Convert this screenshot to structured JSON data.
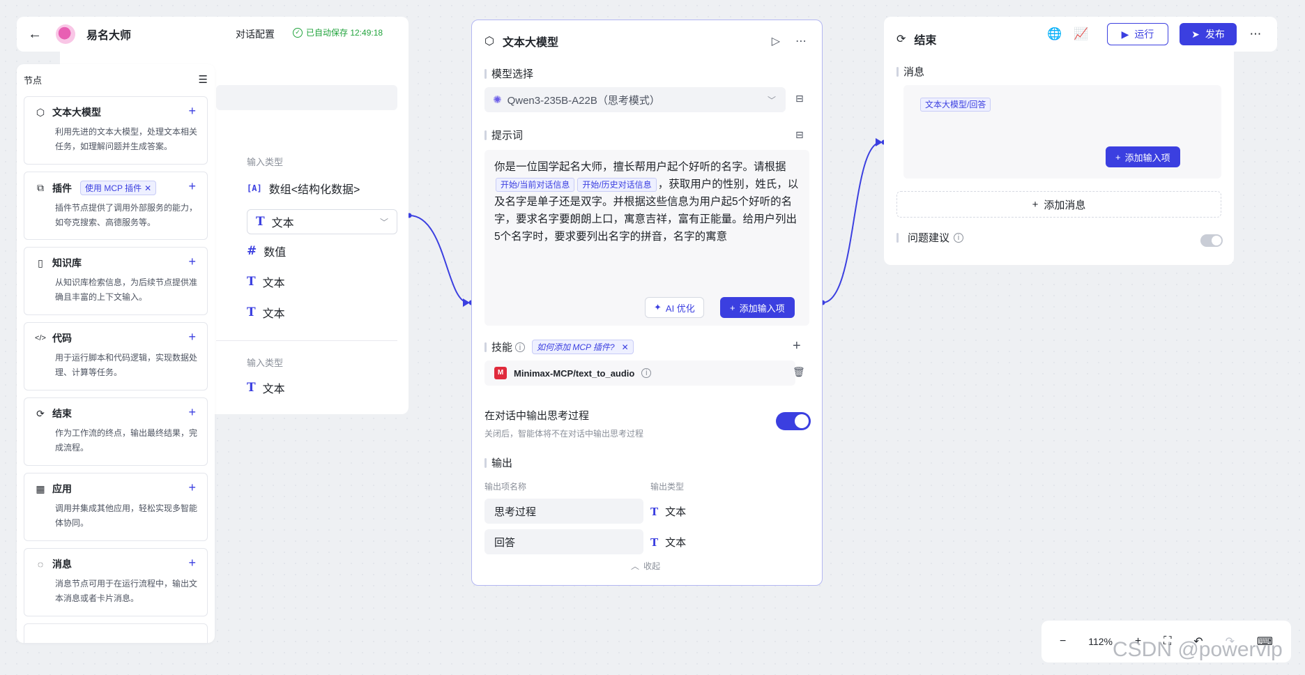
{
  "app": {
    "title": "易名大师",
    "tab_label": "对话配置",
    "autosave": "已自动保存 12:49:18"
  },
  "sidebar": {
    "header": "节点",
    "items": [
      {
        "icon": "cube-icon",
        "title": "文本大模型",
        "desc": "利用先进的文本大模型，处理文本相关任务，如理解问题并生成答案。"
      },
      {
        "icon": "plugin-icon",
        "title": "插件",
        "tag": "使用 MCP 插件",
        "desc": "插件节点提供了调用外部服务的能力，如夸克搜索、高德服务等。"
      },
      {
        "icon": "book-icon",
        "title": "知识库",
        "desc": "从知识库检索信息，为后续节点提供准确且丰富的上下文输入。"
      },
      {
        "icon": "code-icon",
        "title": "代码",
        "desc": "用于运行脚本和代码逻辑，实现数据处理、计算等任务。"
      },
      {
        "icon": "end-icon",
        "title": "结束",
        "desc": "作为工作流的终点，输出最终结果，完成流程。"
      },
      {
        "icon": "apps-icon",
        "title": "应用",
        "desc": "调用并集成其他应用，轻松实现多智能体协同。"
      },
      {
        "icon": "message-icon",
        "title": "消息",
        "desc": "消息节点可用于在运行流程中，输出文本消息或者卡片消息。"
      }
    ]
  },
  "start_node": {
    "input_type_header_1": "输入类型",
    "rows": [
      {
        "icon": "[A]",
        "label": "数组<结构化数据>"
      },
      {
        "icon": "T",
        "label": "文本",
        "is_select": true
      },
      {
        "icon": "#",
        "label": "数值"
      },
      {
        "icon": "T",
        "label": "文本"
      },
      {
        "icon": "T",
        "label": "文本"
      }
    ],
    "input_type_header_2": "输入类型",
    "row_bottom": {
      "icon": "T",
      "label": "文本"
    }
  },
  "llm_node": {
    "title": "文本大模型",
    "model_section": "模型选择",
    "model_value": "Qwen3-235B-A22B（思考模式）",
    "prompt_section": "提示词",
    "prompt_text_1": "你是一位国学起名大师，擅长帮用户起个好听的名字。请根据",
    "prompt_tag_1": "开始/当前对话信息",
    "prompt_tag_2": "开始/历史对话信息",
    "prompt_text_2": "，获取用户的性别，姓氏，以及名字是单子还是双字。并根据这些信息为用户起5个好听的名字，要求名字要朗朗上口，寓意吉祥，富有正能量。给用户列出5个名字时，要求要列出名字的拼音，名字的寓意",
    "ai_optimize": "AI 优化",
    "add_input": "添加输入项",
    "skills_section": "技能",
    "skills_tag": "如何添加 MCP 插件?",
    "skill_name": "Minimax-MCP/text_to_audio",
    "think_title": "在对话中输出思考过程",
    "think_desc": "关闭后，智能体将不在对话中输出思考过程",
    "think_enabled": true,
    "output_section": "输出",
    "out_name_header": "输出项名称",
    "out_type_header": "输出类型",
    "outputs": [
      {
        "name": "思考过程",
        "type": "文本"
      },
      {
        "name": "回答",
        "type": "文本"
      }
    ],
    "collapse": "收起"
  },
  "end_node": {
    "title": "结束",
    "message_section": "消息",
    "message_tag": "文本大模型/回答",
    "add_input": "添加输入项",
    "add_message": "添加消息",
    "suggest_section": "问题建议",
    "suggest_enabled": false
  },
  "toolbar": {
    "run_label": "运行",
    "publish_label": "发布"
  },
  "zoom": {
    "level": "112%"
  },
  "watermark": "CSDN @powervip",
  "colors": {
    "accent": "#3b3fe0",
    "success": "#21a33c"
  }
}
